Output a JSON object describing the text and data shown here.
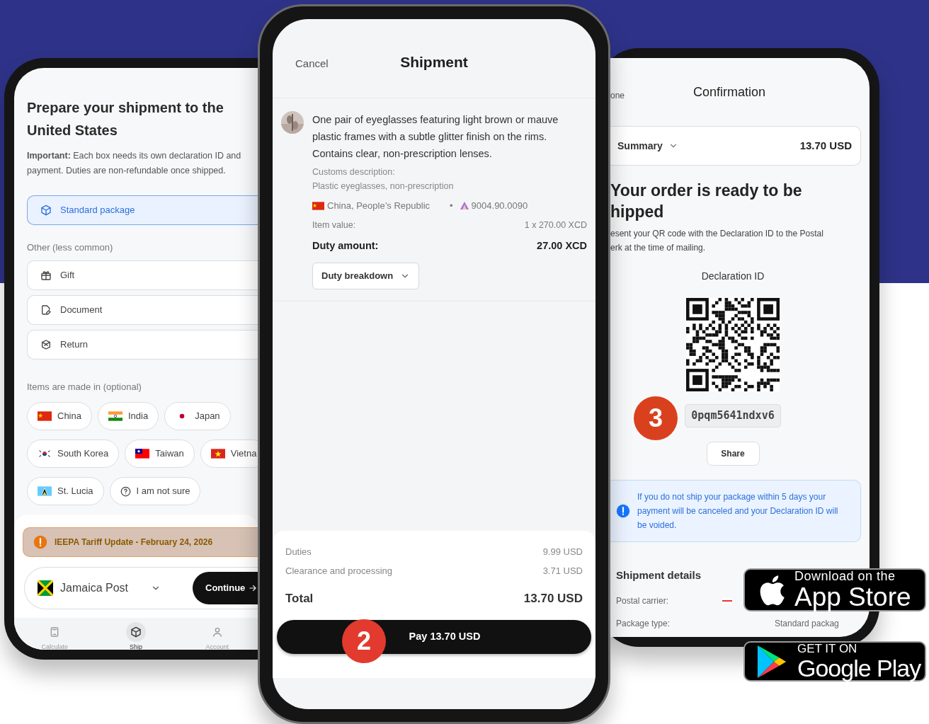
{
  "left_phone": {
    "title": "Prepare your shipment to the United States",
    "notice": "**Important:** Each box needs its own declaration ID and payment. Duties are non-refundable once shipped.",
    "standard_options": [
      {
        "label": "Standard package",
        "selected": true
      }
    ],
    "other_heading": "Other (less common)",
    "other_options": [
      {
        "label": "Gift",
        "selected": false
      },
      {
        "label": "Document",
        "selected": false
      },
      {
        "label": "Return",
        "selected": false
      }
    ],
    "origin_heading": "Items are made in (optional)",
    "origin_rows": [
      [
        {
          "label": "China",
          "kind": "flag"
        },
        {
          "label": "India",
          "kind": "flag"
        },
        {
          "label": "Japan",
          "kind": "flag"
        }
      ],
      [
        {
          "label": "South Korea",
          "kind": "flag"
        },
        {
          "label": "Taiwan",
          "kind": "flag"
        },
        {
          "label": "Vietna",
          "kind": "flag"
        }
      ],
      [
        {
          "label": "St. Lucia",
          "kind": "flag"
        },
        {
          "label": "I am not sure",
          "kind": "unsure"
        }
      ]
    ],
    "alert": "IEEPA Tariff Update - February 24, 2026",
    "carrier": "Jamaica Post",
    "continue_button": "Continue",
    "nav": [
      {
        "label": "Calculate",
        "selected": false
      },
      {
        "label": "Ship",
        "selected": true
      },
      {
        "label": "Account",
        "selected": false
      }
    ]
  },
  "middle_phone": {
    "cancel": "Cancel",
    "title": "Shipment",
    "item": {
      "description": "One pair of eyeglasses featuring light brown or mauve plastic frames with a subtle glitter finish on the rims. Contains clear, non-prescription lenses.",
      "customs_label": "Customs description:",
      "customs_value": "Plastic eyeglasses, non-prescription",
      "origin": "China, People’s Republic",
      "separator": "•",
      "hs_code": "9004.90.0090",
      "value_label": "Item value:",
      "value": "1 x 270.00 XCD",
      "duty_label": "Duty amount:",
      "duty": "27.00 XCD",
      "breakdown_button": "Duty breakdown"
    },
    "summary": [
      {
        "label": "Duties",
        "value": "9.99 USD",
        "kind": "line"
      },
      {
        "label": "Clearance and processing",
        "value": "3.71 USD",
        "kind": "line"
      },
      {
        "label": "Total",
        "value": "13.70 USD",
        "kind": "total"
      }
    ],
    "pay_button": "Pay 13.70 USD",
    "step_badge": "2"
  },
  "right_phone": {
    "done": "one",
    "title": "Confirmation",
    "summary_label": "Summary",
    "summary_total": "13.70 USD",
    "heading_lines": [
      "Your order is ready to be",
      "hipped"
    ],
    "instruction_lines": [
      "esent your QR code with the Declaration ID to the Postal",
      "erk at the time of mailing."
    ],
    "declaration_label": "Declaration ID",
    "declaration_id": "0pqm5641ndxv6",
    "step_badge": "3",
    "share_button": "Share",
    "notice": "If you do not ship your package within 5 days your payment will be canceled and your Declaration ID will be voided.",
    "details_heading": "Shipment details",
    "details": [
      {
        "label": "Postal carrier:",
        "kind": "flag"
      },
      {
        "label": "Package type:",
        "value": "Standard packag",
        "kind": "text"
      }
    ]
  },
  "store_badges": [
    {
      "kind": "apple",
      "small": "Download on the",
      "large": "App Store"
    },
    {
      "kind": "google",
      "small": "GET IT ON",
      "large": "Google Play"
    }
  ]
}
